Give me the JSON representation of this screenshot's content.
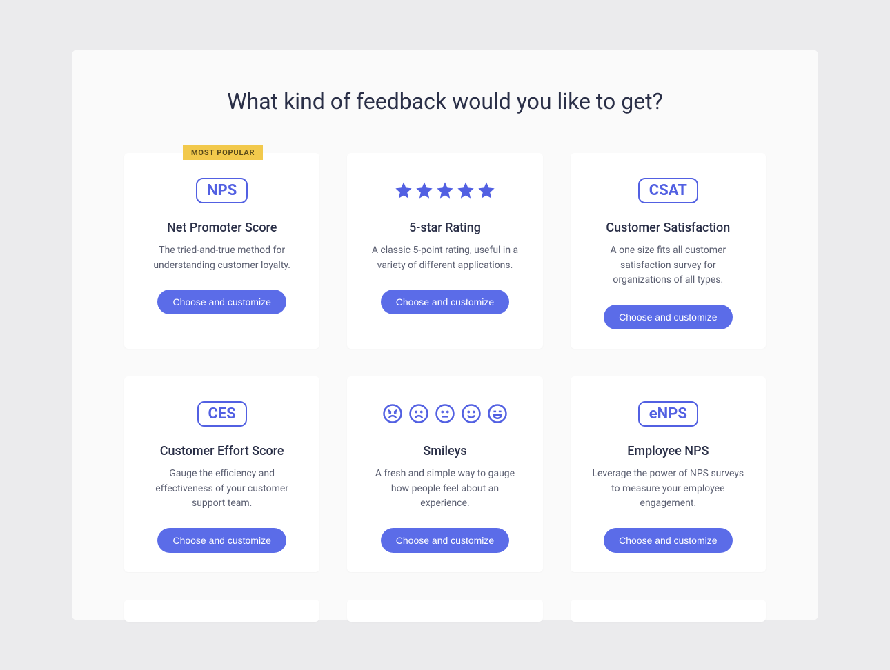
{
  "title": "What kind of feedback would you like to get?",
  "badge": {
    "most_popular": "MOST POPULAR"
  },
  "button_label": "Choose and customize",
  "cards": [
    {
      "icon_type": "pill",
      "icon_label": "NPS",
      "title": "Net Promoter Score",
      "description": "The tried-and-true method for understanding customer loyalty.",
      "most_popular": true
    },
    {
      "icon_type": "stars",
      "icon_label": "",
      "title": "5-star Rating",
      "description": "A classic 5-point rating, useful in a variety of different applications.",
      "most_popular": false
    },
    {
      "icon_type": "pill",
      "icon_label": "CSAT",
      "title": "Customer Satisfaction",
      "description": "A one size fits all customer satisfaction survey for organizations of all types.",
      "most_popular": false
    },
    {
      "icon_type": "pill",
      "icon_label": "CES",
      "title": "Customer Effort Score",
      "description": "Gauge the efficiency and effectiveness of your customer support team.",
      "most_popular": false
    },
    {
      "icon_type": "smileys",
      "icon_label": "",
      "title": "Smileys",
      "description": "A fresh and simple way to gauge how people feel about an experience.",
      "most_popular": false
    },
    {
      "icon_type": "pill",
      "icon_label": "eNPS",
      "title": "Employee NPS",
      "description": "Leverage the power of NPS surveys to measure your employee engagement.",
      "most_popular": false
    }
  ]
}
